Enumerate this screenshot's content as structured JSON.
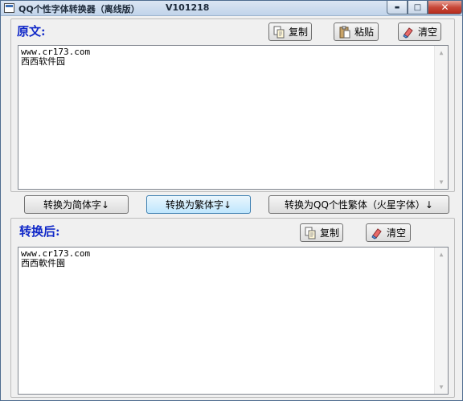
{
  "window": {
    "title": "QQ个性字体转换器（离线版）",
    "version": "V101218",
    "controls": {
      "minimize": "▬",
      "maximize": "□",
      "close": "✕"
    }
  },
  "source": {
    "label": "原文:",
    "copy_label": "复制",
    "paste_label": "粘贴",
    "clear_label": "清空",
    "text_lines": [
      "www.cr173.com",
      "西西软件园"
    ]
  },
  "convert": {
    "simplified_label": "转换为简体字↓",
    "traditional_label": "转换为繁体字↓",
    "qq_label": "转换为QQ个性繁体（火星字体）↓"
  },
  "result": {
    "label": "转换后:",
    "copy_label": "复制",
    "clear_label": "清空",
    "text_lines": [
      "www.cr173.com",
      "西西軟件園"
    ]
  },
  "scrollbar": {
    "up_arrow": "▲",
    "down_arrow": "▼"
  },
  "icons": {
    "copy": "copy-icon",
    "paste": "paste-icon",
    "clear": "eraser-icon"
  },
  "colors": {
    "section_label": "#1028c8",
    "title_bar": "#c1d4ea",
    "close_button": "#c7493a"
  }
}
